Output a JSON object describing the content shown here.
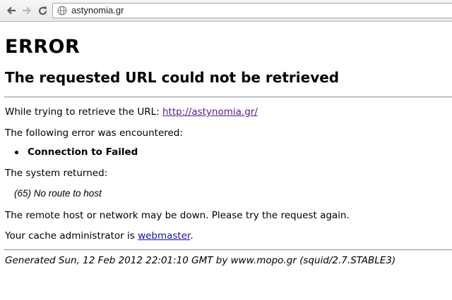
{
  "browser": {
    "url": "astynomia.gr",
    "icons": {
      "back": "back-arrow-icon",
      "forward": "forward-arrow-icon",
      "reload": "reload-icon",
      "site": "globe-icon"
    }
  },
  "page": {
    "heading": "ERROR",
    "subheading": "The requested URL could not be retrieved",
    "retrieve_prefix": "While trying to retrieve the URL: ",
    "retrieve_url": "http://astynomia.gr/",
    "encountered_text": "The following error was encountered:",
    "errors": [
      "Connection to Failed"
    ],
    "system_returned_label": "The system returned:",
    "system_returned_value": "(65) No route to host",
    "remote_down_text": "The remote host or network may be down. Please try the request again.",
    "cache_admin_prefix": "Your cache administrator is ",
    "cache_admin_link": "webmaster",
    "cache_admin_suffix": ".",
    "footer": "Generated Sun, 12 Feb 2012 22:01:10 GMT by www.mopo.gr (squid/2.7.STABLE3)"
  },
  "colors": {
    "visited_link": "#551a8b",
    "link": "#1a0dab"
  }
}
